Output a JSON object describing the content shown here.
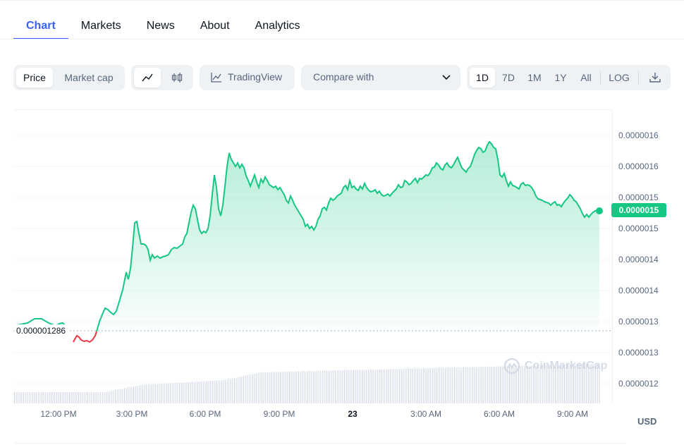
{
  "tabs": [
    {
      "label": "Chart",
      "active": true
    },
    {
      "label": "Markets"
    },
    {
      "label": "News"
    },
    {
      "label": "About"
    },
    {
      "label": "Analytics"
    }
  ],
  "toolbar": {
    "price_label": "Price",
    "market_cap_label": "Market cap",
    "line_icon": "line-chart-icon",
    "candle_icon": "candlestick-icon",
    "tradingview_label": "TradingView",
    "compare_label": "Compare with",
    "ranges": [
      "1D",
      "7D",
      "1M",
      "1Y",
      "All"
    ],
    "active_range": "1D",
    "log_label": "LOG",
    "download_icon": "download-icon"
  },
  "chart_data": {
    "type": "area",
    "y_axis_labels": [
      "0.0000016",
      "0.0000016",
      "0.0000015",
      "0.0000015",
      "0.0000015",
      "0.0000014",
      "0.0000014",
      "0.0000013",
      "0.0000013",
      "0.0000012"
    ],
    "current_price": "0.0000015",
    "open_price": "0.000001286",
    "x_axis_labels": [
      "12:00 PM",
      "3:00 PM",
      "6:00 PM",
      "23",
      "9:00 PM",
      "3:00 AM",
      "6:00 AM",
      "9:00 AM"
    ],
    "currency": "USD",
    "colors": {
      "up": "#16c784",
      "down": "#ea3943",
      "volume": "#cfd6e4"
    }
  },
  "watermark": "CoinMarketCap"
}
